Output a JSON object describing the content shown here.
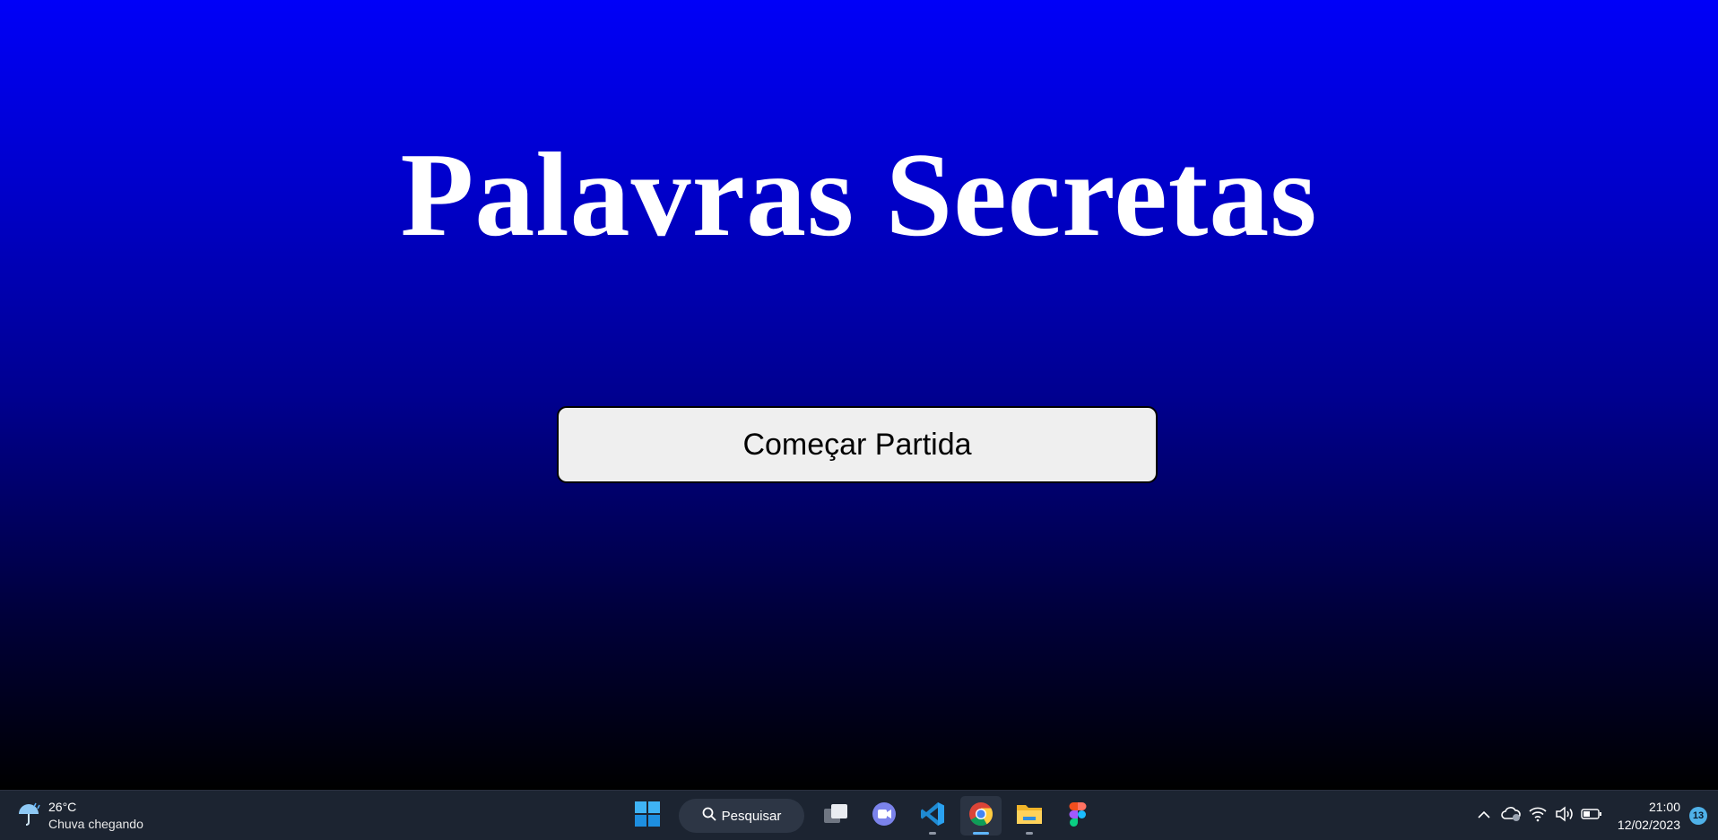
{
  "app": {
    "title": "Palavras Secretas",
    "start_button": "Começar Partida"
  },
  "taskbar": {
    "weather": {
      "temperature": "26°C",
      "description": "Chuva chegando",
      "icon": "umbrella-rain-icon"
    },
    "search_label": "Pesquisar",
    "pinned": [
      {
        "name": "windows-start-icon"
      },
      {
        "name": "task-view-icon"
      },
      {
        "name": "teams-meet-icon"
      },
      {
        "name": "vscode-icon"
      },
      {
        "name": "chrome-icon"
      },
      {
        "name": "file-explorer-icon"
      },
      {
        "name": "figma-icon"
      }
    ],
    "clock": {
      "time": "21:00",
      "date": "12/02/2023"
    },
    "notifications": "13"
  },
  "colors": {
    "gradient_top": "#0000f8",
    "gradient_bottom": "#000000",
    "button_bg": "#efefef",
    "taskbar_bg": "#1c2431"
  }
}
